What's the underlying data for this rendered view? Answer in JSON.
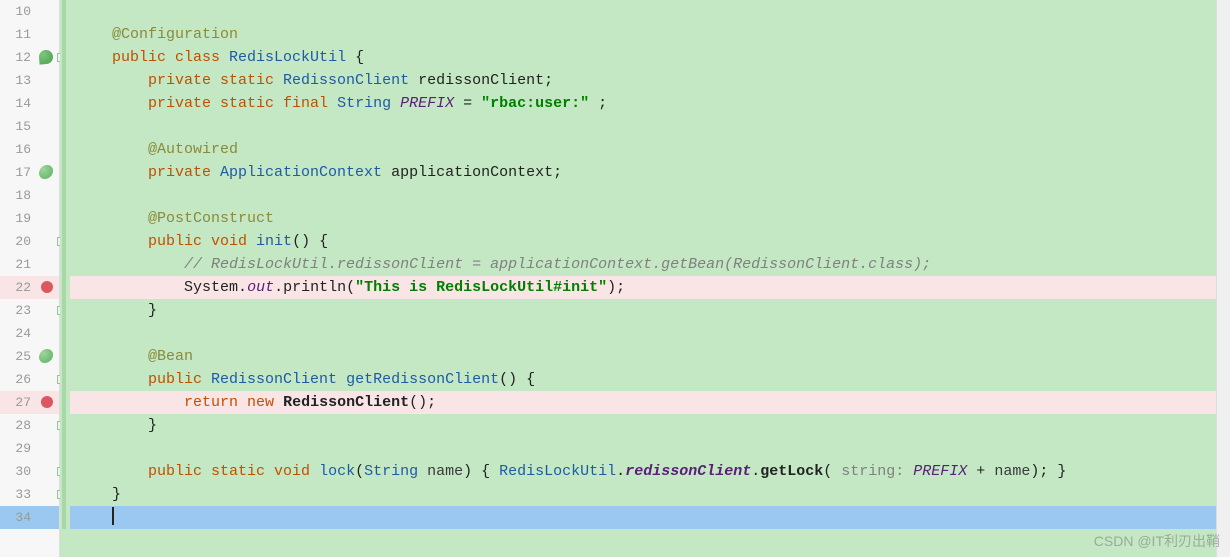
{
  "lines": [
    {
      "num": "10",
      "indent": 0,
      "tokens": []
    },
    {
      "num": "11",
      "indent": 1,
      "tokens": [
        {
          "t": "@Configuration",
          "c": "tok-ann"
        }
      ]
    },
    {
      "num": "12",
      "indent": 1,
      "icon": "spring",
      "fold": true,
      "tokens": [
        {
          "t": "public ",
          "c": "tok-kw"
        },
        {
          "t": "class ",
          "c": "tok-kw"
        },
        {
          "t": "RedisLockUtil ",
          "c": "tok-type"
        },
        {
          "t": "{",
          "c": "tok-ident"
        }
      ]
    },
    {
      "num": "13",
      "indent": 2,
      "tokens": [
        {
          "t": "private ",
          "c": "tok-kw"
        },
        {
          "t": "static ",
          "c": "tok-kw"
        },
        {
          "t": "RedissonClient ",
          "c": "tok-type"
        },
        {
          "t": "redissonClient",
          "c": "tok-ident"
        },
        {
          "t": ";",
          "c": "tok-ident"
        }
      ]
    },
    {
      "num": "14",
      "indent": 2,
      "tokens": [
        {
          "t": "private ",
          "c": "tok-kw"
        },
        {
          "t": "static ",
          "c": "tok-kw"
        },
        {
          "t": "final ",
          "c": "tok-kw"
        },
        {
          "t": "String ",
          "c": "tok-type"
        },
        {
          "t": "PREFIX ",
          "c": "tok-static-field"
        },
        {
          "t": "= ",
          "c": "tok-ident"
        },
        {
          "t": "\"rbac:user:\" ",
          "c": "tok-str"
        },
        {
          "t": ";",
          "c": "tok-ident"
        }
      ]
    },
    {
      "num": "15",
      "indent": 0,
      "tokens": []
    },
    {
      "num": "16",
      "indent": 2,
      "tokens": [
        {
          "t": "@Autowired",
          "c": "tok-ann"
        }
      ]
    },
    {
      "num": "17",
      "indent": 2,
      "icon": "bean",
      "tokens": [
        {
          "t": "private ",
          "c": "tok-kw"
        },
        {
          "t": "ApplicationContext ",
          "c": "tok-type"
        },
        {
          "t": "applicationContext",
          "c": "tok-ident"
        },
        {
          "t": ";",
          "c": "tok-ident"
        }
      ]
    },
    {
      "num": "18",
      "indent": 0,
      "tokens": []
    },
    {
      "num": "19",
      "indent": 2,
      "tokens": [
        {
          "t": "@PostConstruct",
          "c": "tok-ann"
        }
      ]
    },
    {
      "num": "20",
      "indent": 2,
      "fold": true,
      "tokens": [
        {
          "t": "public ",
          "c": "tok-kw"
        },
        {
          "t": "void ",
          "c": "tok-kw"
        },
        {
          "t": "init",
          "c": "tok-method"
        },
        {
          "t": "() {",
          "c": "tok-ident"
        }
      ]
    },
    {
      "num": "21",
      "indent": 3,
      "tokens": [
        {
          "t": "// RedisLockUtil.redissonClient = applicationContext.getBean(RedissonClient.class);",
          "c": "tok-comment"
        }
      ]
    },
    {
      "num": "22",
      "indent": 3,
      "breakpoint": true,
      "tokens": [
        {
          "t": "System",
          "c": "tok-ident"
        },
        {
          "t": ".",
          "c": "tok-ident"
        },
        {
          "t": "out",
          "c": "tok-static-field"
        },
        {
          "t": ".",
          "c": "tok-ident"
        },
        {
          "t": "println(",
          "c": "tok-ident"
        },
        {
          "t": "\"This is RedisLockUtil#init\"",
          "c": "tok-str tok-bold"
        },
        {
          "t": ");",
          "c": "tok-ident"
        }
      ]
    },
    {
      "num": "23",
      "indent": 2,
      "fold": true,
      "tokens": [
        {
          "t": "}",
          "c": "tok-ident"
        }
      ]
    },
    {
      "num": "24",
      "indent": 0,
      "tokens": []
    },
    {
      "num": "25",
      "indent": 2,
      "icon": "bean",
      "tokens": [
        {
          "t": "@Bean",
          "c": "tok-ann"
        }
      ]
    },
    {
      "num": "26",
      "indent": 2,
      "fold": true,
      "tokens": [
        {
          "t": "public ",
          "c": "tok-kw"
        },
        {
          "t": "RedissonClient ",
          "c": "tok-type"
        },
        {
          "t": "getRedissonClient",
          "c": "tok-method"
        },
        {
          "t": "() {",
          "c": "tok-ident"
        }
      ]
    },
    {
      "num": "27",
      "indent": 3,
      "breakpoint": true,
      "tokens": [
        {
          "t": "return ",
          "c": "tok-kw"
        },
        {
          "t": "new ",
          "c": "tok-kw"
        },
        {
          "t": "RedissonClient",
          "c": "tok-ident tok-bold"
        },
        {
          "t": "();",
          "c": "tok-ident"
        }
      ]
    },
    {
      "num": "28",
      "indent": 2,
      "fold": true,
      "tokens": [
        {
          "t": "}",
          "c": "tok-ident"
        }
      ]
    },
    {
      "num": "29",
      "indent": 0,
      "tokens": []
    },
    {
      "num": "30",
      "indent": 2,
      "fold": true,
      "tokens": [
        {
          "t": "public ",
          "c": "tok-kw"
        },
        {
          "t": "static ",
          "c": "tok-kw"
        },
        {
          "t": "void ",
          "c": "tok-kw"
        },
        {
          "t": "lock",
          "c": "tok-method"
        },
        {
          "t": "(",
          "c": "tok-ident"
        },
        {
          "t": "String ",
          "c": "tok-type"
        },
        {
          "t": "name",
          "c": "tok-param"
        },
        {
          "t": ") { ",
          "c": "tok-ident"
        },
        {
          "t": "RedisLockUtil",
          "c": "tok-type"
        },
        {
          "t": ".",
          "c": "tok-ident"
        },
        {
          "t": "redissonClient",
          "c": "tok-static-field tok-bold"
        },
        {
          "t": ".",
          "c": "tok-ident"
        },
        {
          "t": "getLock",
          "c": "tok-ident tok-bold"
        },
        {
          "t": "( ",
          "c": "tok-ident"
        },
        {
          "t": "string: ",
          "c": "tok-hint"
        },
        {
          "t": "PREFIX ",
          "c": "tok-static-field"
        },
        {
          "t": "+ ",
          "c": "tok-ident"
        },
        {
          "t": "name",
          "c": "tok-param"
        },
        {
          "t": "); }",
          "c": "tok-ident"
        }
      ]
    },
    {
      "num": "33",
      "indent": 1,
      "fold": true,
      "tokens": [
        {
          "t": "}",
          "c": "tok-ident"
        }
      ]
    },
    {
      "num": "34",
      "indent": 1,
      "current": true,
      "caret": true,
      "tokens": []
    }
  ],
  "watermark": "CSDN @IT利刃出鞘",
  "indent_unit": "    "
}
